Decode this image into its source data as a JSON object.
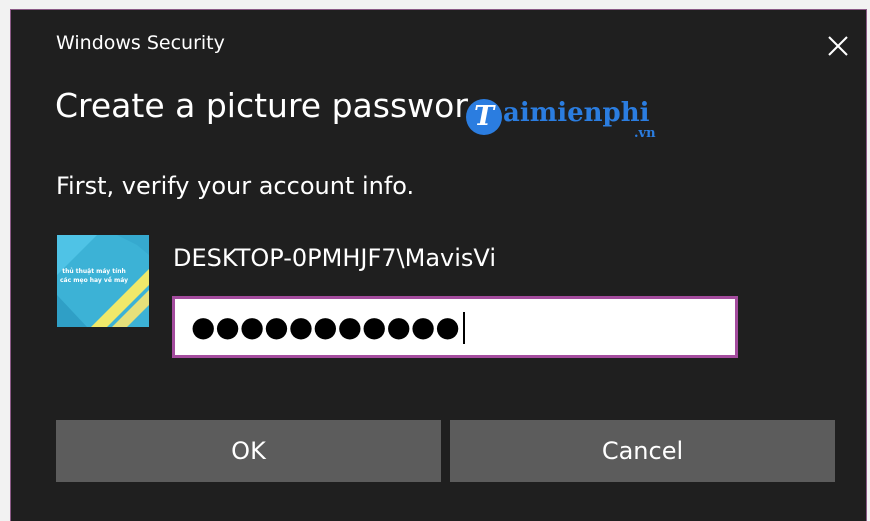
{
  "dialog": {
    "title": "Windows Security",
    "heading": "Create a picture passwor",
    "subtitle": "First, verify your account info.",
    "account_name": "DESKTOP-0PMHJF7\\MavisVi",
    "password_masked": "●●●●●●●●●●●",
    "ok_label": "OK",
    "cancel_label": "Cancel",
    "close_icon": "close-icon"
  },
  "watermark": {
    "letter": "T",
    "text": "aimienphi",
    "suffix": ".vn",
    "color": "#2b7de0"
  },
  "avatar": {
    "caption_line1": "thủ thuật máy tính",
    "caption_line2": "các mẹo hay về máy tính"
  },
  "colors": {
    "dialog_background": "#1f1f1f",
    "button_background": "#5c5c5c",
    "focus_border": "#a44c9e"
  }
}
